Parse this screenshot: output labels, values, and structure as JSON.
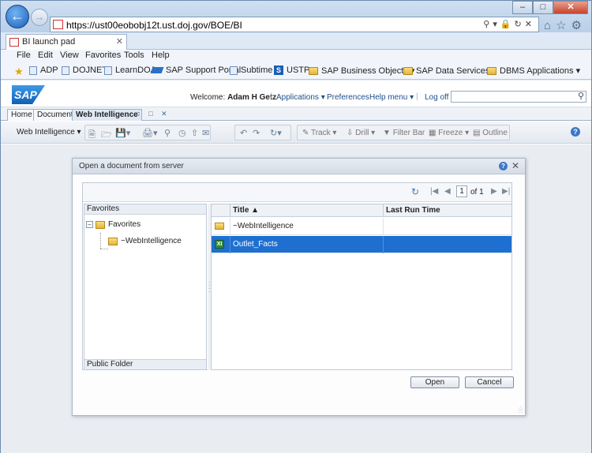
{
  "browser": {
    "url": "https://ust00eobobj12t.ust.doj.gov/BOE/BI",
    "tab_title": "BI launch pad",
    "menu": [
      "File",
      "Edit",
      "View",
      "Favorites",
      "Tools",
      "Help"
    ],
    "favorites": [
      "ADP",
      "DOJNET",
      "LearnDOJ",
      "SAP Support Portal",
      "Subtime",
      "USTP",
      "SAP Business Objects",
      "SAP Data Services",
      "DBMS Applications"
    ]
  },
  "bi_header": {
    "welcome_label": "Welcome:",
    "user": "Adam H Getz",
    "applications": "Applications",
    "preferences": "Preferences",
    "help_menu": "Help menu",
    "logoff": "Log off",
    "logo": "SAP"
  },
  "bi_tabs": [
    "Home",
    "Documents",
    "Web Intelligence"
  ],
  "toolbar": {
    "wi_menu": "Web Intelligence",
    "track": "Track",
    "drill": "Drill",
    "filter_bar": "Filter Bar",
    "freeze": "Freeze",
    "outline": "Outline"
  },
  "dialog": {
    "title": "Open a document from server",
    "pager": {
      "page": "1",
      "of": "of 1"
    },
    "left_pane": {
      "header": "Favorites",
      "footer": "Public Folder",
      "tree": [
        "Favorites",
        "~WebIntelligence"
      ]
    },
    "columns": [
      "Title",
      "Last Run Time"
    ],
    "rows": [
      {
        "title": "~WebIntelligence",
        "last_run": "",
        "type": "folder"
      },
      {
        "title": "Outlet_Facts",
        "last_run": "",
        "type": "document"
      }
    ],
    "open_button": "Open",
    "cancel_button": "Cancel"
  }
}
